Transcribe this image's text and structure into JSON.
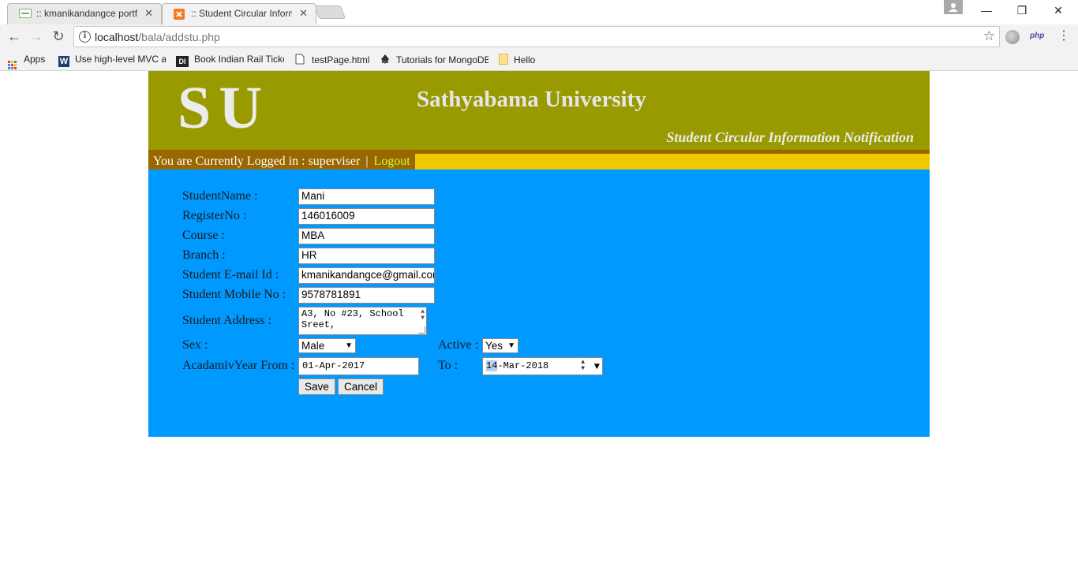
{
  "browser": {
    "tabs": [
      {
        "title": ":: kmanikandangce portfolio",
        "active": false
      },
      {
        "title": ":: Student Circular Information",
        "active": true
      }
    ],
    "url_host": "localhost",
    "url_path": "/bala/addstu.php",
    "bookmarks": [
      {
        "label": "Apps",
        "icon": "apps-grid-icon"
      },
      {
        "label": "Use high-level MVC and",
        "icon": "w-logo-icon"
      },
      {
        "label": "Book Indian Rail Tickets",
        "icon": "di-logo-icon"
      },
      {
        "label": "testPage.html",
        "icon": "page-icon"
      },
      {
        "label": "Tutorials for MongoDB",
        "icon": "mongodb-icon"
      },
      {
        "label": "Hello",
        "icon": "folder-icon"
      }
    ],
    "extensions": {
      "php_label": "php"
    }
  },
  "header": {
    "logo": "SU",
    "title": "Sathyabama University",
    "tagline": "Student Circular Information Notification"
  },
  "login_bar": {
    "text": "You are Currently Logged in : superviser",
    "separator": "|",
    "logout": "Logout"
  },
  "form": {
    "student_name": {
      "label": "StudentName :",
      "value": "Mani"
    },
    "register_no": {
      "label": "RegisterNo :",
      "value": "146016009"
    },
    "course": {
      "label": "Course :",
      "value": "MBA"
    },
    "branch": {
      "label": "Branch :",
      "value": "HR"
    },
    "email": {
      "label": "Student E-mail Id :",
      "value": "kmanikandangce@gmail.com"
    },
    "mobile": {
      "label": "Student Mobile No :",
      "value": "9578781891"
    },
    "address": {
      "label": "Student Address :",
      "value": "A3, No #23, School\nSreet,"
    },
    "sex": {
      "label": "Sex :",
      "value": "Male"
    },
    "active": {
      "label": "Active :",
      "value": "Yes"
    },
    "year_from": {
      "label": "AcadamivYear From :",
      "value": "01-Apr-2017"
    },
    "year_to": {
      "label": "To :",
      "day": "14",
      "rest": "-Mar-2018"
    },
    "save_label": "Save",
    "cancel_label": "Cancel"
  },
  "colors": {
    "header_bg": "#999900",
    "login_bar_bg": "#f0c800",
    "content_bg": "#0099ff",
    "logout_link": "#ccff33"
  }
}
